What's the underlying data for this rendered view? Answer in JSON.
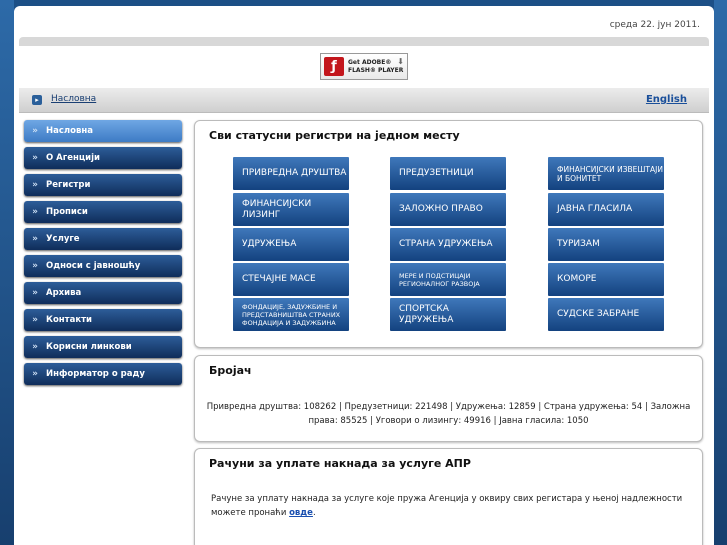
{
  "header": {
    "date": "среда 22. јун 2011."
  },
  "flash": {
    "line1": "Get ADOBE®",
    "line2": "FLASH® PLAYER"
  },
  "navbar": {
    "crumb": "Насловна",
    "language": "English"
  },
  "menu": [
    {
      "label": "Насловна"
    },
    {
      "label": "О Агенцији"
    },
    {
      "label": "Регистри"
    },
    {
      "label": "Прописи"
    },
    {
      "label": "Услуге"
    },
    {
      "label": "Односи с јавношћу"
    },
    {
      "label": "Архива"
    },
    {
      "label": "Контакти"
    },
    {
      "label": "Корисни линкови"
    },
    {
      "label": "Информатор о раду"
    }
  ],
  "registers": {
    "title": "Сви статусни регистри на једном месту",
    "items": [
      {
        "label": "Привредна друштва"
      },
      {
        "label": "Предузетници"
      },
      {
        "label": "Финансијски извештаји и бонитет"
      },
      {
        "label": "Финансијски лизинг"
      },
      {
        "label": "Заложно право"
      },
      {
        "label": "Јавна гласила"
      },
      {
        "label": "Удружења"
      },
      {
        "label": "Страна удружења"
      },
      {
        "label": "Туризам"
      },
      {
        "label": "Стечајне масе"
      },
      {
        "label": "Мере и подстицаји регионалног развоја"
      },
      {
        "label": "Коморе"
      },
      {
        "label": "Фондације, задужбине и представништва страних фондација и задужбина"
      },
      {
        "label": "Спортска удружења"
      },
      {
        "label": "Судске забране"
      }
    ]
  },
  "counter": {
    "title": "Бројач",
    "stats": "Привредна друштва: 108262 | Предузетници: 221498 | Удружења: 12859 | Страна удружења: 54 | Заложна права: 85525 | Уговори о лизингу: 49916 | Јавна гласила: 1050"
  },
  "accounts": {
    "title": "Рачуни за уплате накнада за услуге АПР",
    "text": "Рачуне за уплату накнада за услуге које пружа Агенција у оквиру свих регистара у њеној надлежности можете пронаћи",
    "link": "овде",
    "end": "."
  }
}
